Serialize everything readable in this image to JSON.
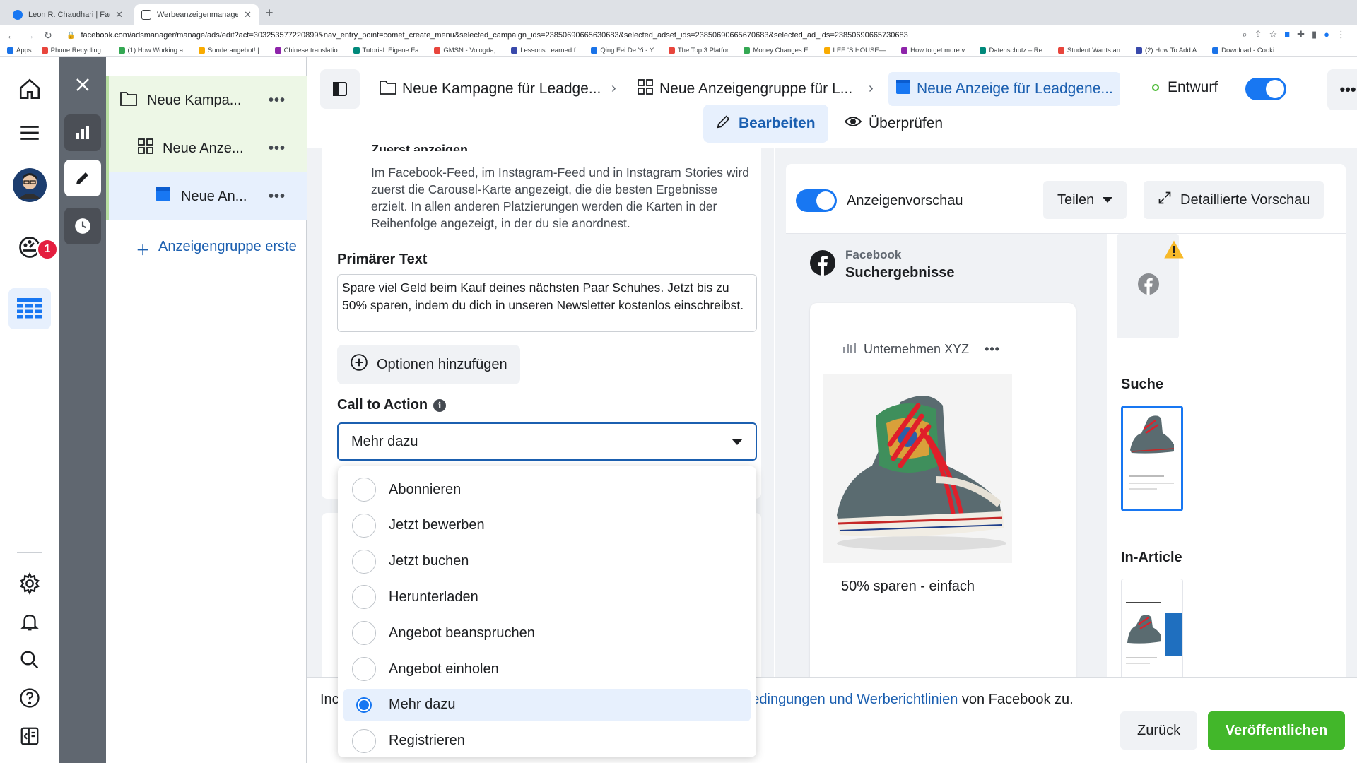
{
  "browser": {
    "tabs": [
      {
        "title": "Leon R. Chaudhari | Facebook"
      },
      {
        "title": "Werbeanzeigenmanager - We"
      }
    ],
    "url": "facebook.com/adsmanager/manage/ads/edit?act=303253577220899&nav_entry_point=comet_create_menu&selected_campaign_ids=23850690665630683&selected_adset_ids=23850690665670683&selected_ad_ids=23850690665730683",
    "bookmarks": [
      "Apps",
      "Phone Recycling,...",
      "(1) How Working a...",
      "Sonderangebot! |...",
      "Chinese translatio...",
      "Tutorial: Eigene Fa...",
      "GMSN - Vologda,...",
      "Lessons Learned f...",
      "Qing Fei De Yi - Y...",
      "The Top 3 Platfor...",
      "Money Changes E...",
      "LEE 'S HOUSE—...",
      "How to get more v...",
      "Datenschutz – Re...",
      "Student Wants an...",
      "(2) How To Add A...",
      "Download - Cooki..."
    ]
  },
  "leftnav": {
    "notification_count": "1"
  },
  "tree": {
    "campaign": "Neue Kampa...",
    "adset": "Neue Anze...",
    "ad": "Neue An...",
    "create_adset": "Anzeigengruppe erste"
  },
  "header": {
    "breadcrumbs": [
      "Neue Kampagne für Leadge...",
      "Neue Anzeigengruppe für L...",
      "Neue Anzeige für Leadgene..."
    ],
    "status": "Entwurf",
    "mode_edit": "Bearbeiten",
    "mode_review": "Überprüfen"
  },
  "editor": {
    "cropped_heading": "Zuerst anzeigen",
    "helptext": "Im Facebook-Feed, im Instagram-Feed und in Instagram Stories wird zuerst die Carousel-Karte angezeigt, die die besten Ergebnisse erzielt. In allen anderen Platzierungen werden die Karten in der Reihenfolge angezeigt, in der du sie anordnest.",
    "primary_text_label": "Primärer Text",
    "primary_text_value": "Spare viel Geld beim Kauf deines nächsten Paar Schuhes. Jetzt bis zu 50% sparen, indem du dich in unseren Newsletter kostenlos einschreibst.",
    "add_options": "Optionen hinzufügen",
    "cta_label": "Call to Action",
    "cta_selected": "Mehr dazu",
    "cta_options": [
      "Abonnieren",
      "Jetzt bewerben",
      "Jetzt buchen",
      "Herunterladen",
      "Angebot beanspruchen",
      "Angebot einholen",
      "Mehr dazu",
      "Registrieren"
    ]
  },
  "preview": {
    "toggle_label": "Anzeigenvorschau",
    "share": "Teilen",
    "detailed": "Detaillierte Vorschau",
    "platform_small": "Facebook",
    "platform_big": "Suchergebnisse",
    "advertiser": "Unternehmen XYZ",
    "caption": "50% sparen - einfach",
    "section_search": "Suche",
    "section_inarticle": "In-Article"
  },
  "footer": {
    "terms_start": "Inc",
    "terms_link": "edingungen und Werberichtlinien",
    "terms_end": " von Facebook zu.",
    "back": "Zurück",
    "publish": "Veröffentlichen"
  },
  "colors": {
    "accent": "#1877f2",
    "link": "#1b5fb0",
    "publish": "#42b72a",
    "notification": "#e41e3f"
  }
}
